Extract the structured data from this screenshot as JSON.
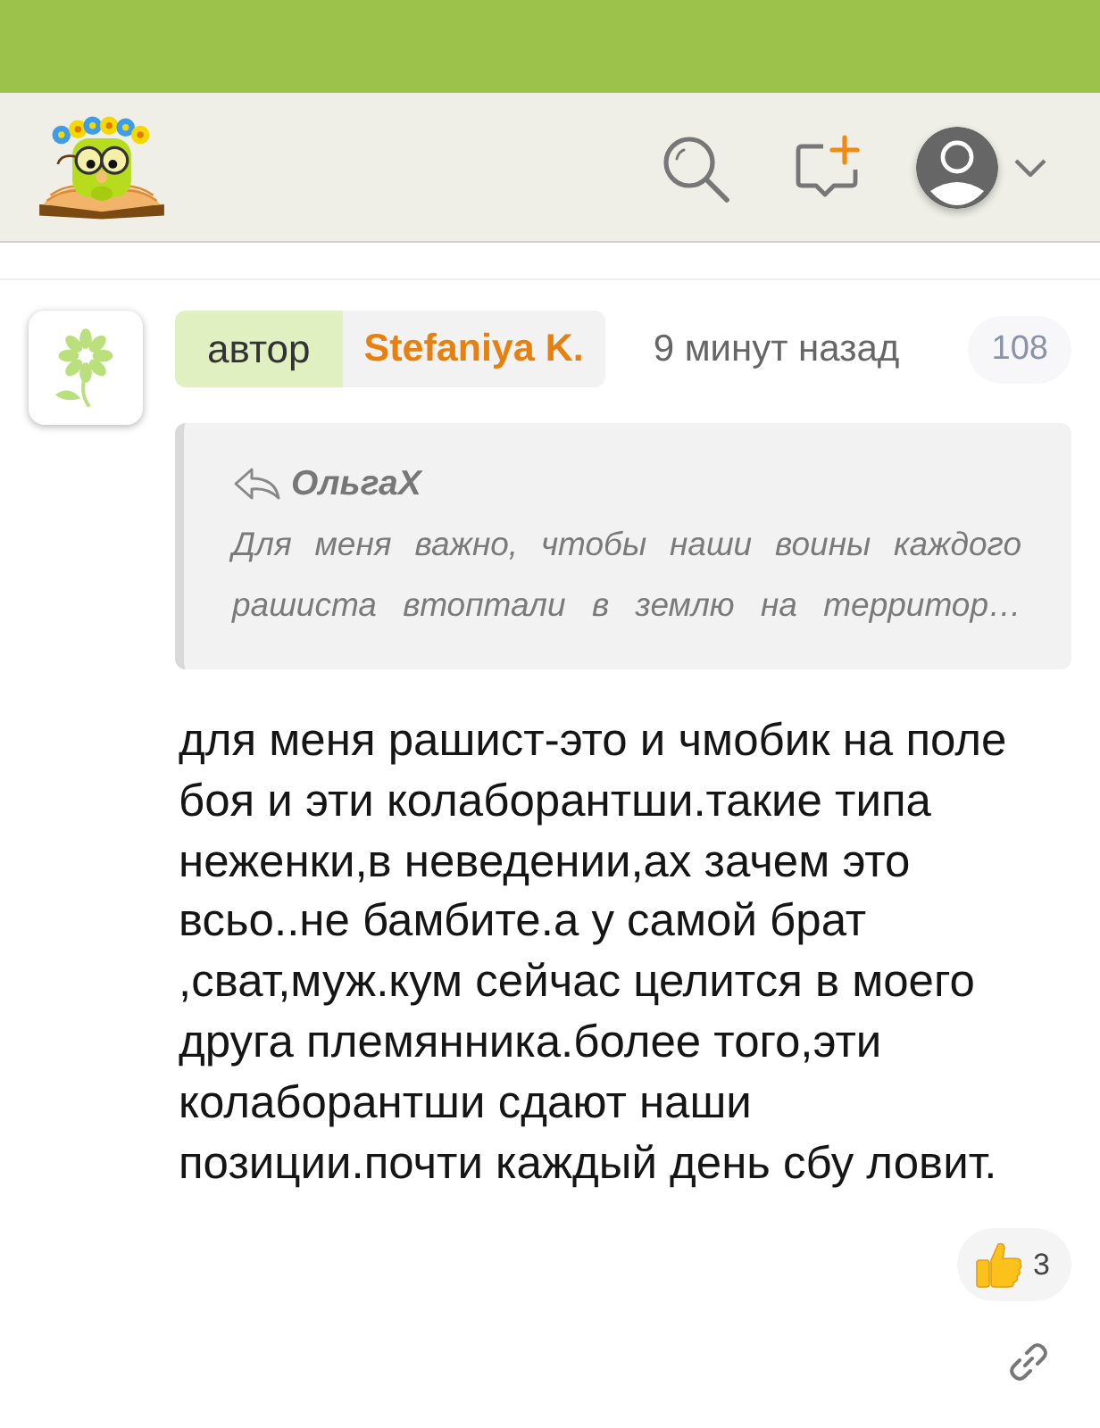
{
  "comment": {
    "author_role": "автор",
    "author_name": "Stefaniya K.",
    "time": "9 минут назад",
    "number": "108",
    "quote": {
      "author": "ОльгаХ",
      "text": "Для меня важно, чтобы наши воины каждого рашиста втоптали в землю на территор…"
    },
    "body": "для меня рашист-это и чмобик на поле боя и эти колаборантши.такие типа неженки,в неведении,ах зачем это всьо..не бамбите.а у самой брат ,сват,муж.кум сейчас целится в моего друга племянника.более того,эти колаборантши сдают наши позиции.почти каждый день сбу ловит.",
    "reactions": [
      {
        "kind": "like",
        "count": "3"
      }
    ]
  }
}
